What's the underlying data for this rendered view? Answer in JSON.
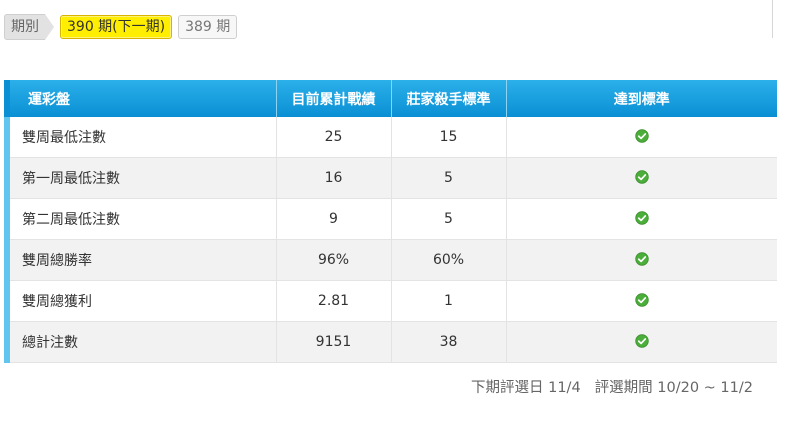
{
  "period_selector": {
    "label": "期別",
    "current": "390 期(下一期)",
    "previous": "389 期"
  },
  "table": {
    "headers": [
      "運彩盤",
      "目前累計戰績",
      "莊家殺手標準",
      "達到標準"
    ],
    "rows": [
      {
        "name": "雙周最低注數",
        "current": "25",
        "standard": "15",
        "met": true
      },
      {
        "name": "第一周最低注數",
        "current": "16",
        "standard": "5",
        "met": true
      },
      {
        "name": "第二周最低注數",
        "current": "9",
        "standard": "5",
        "met": true
      },
      {
        "name": "雙周總勝率",
        "current": "96%",
        "standard": "60%",
        "met": true
      },
      {
        "name": "雙周總獲利",
        "current": "2.81",
        "standard": "1",
        "met": true
      },
      {
        "name": "總計注數",
        "current": "9151",
        "standard": "38",
        "met": true
      }
    ]
  },
  "footer": {
    "next_selection_date": "下期評選日 11/4",
    "selection_period": "評選期間 10/20 ~ 11/2"
  },
  "colors": {
    "header_blue": "#1aa0e0",
    "row_accent": "#61c6ef",
    "check_green": "#4cae3a",
    "current_period_yellow": "#ffee00"
  },
  "icons": {
    "met_icon": "check-circle-icon"
  }
}
